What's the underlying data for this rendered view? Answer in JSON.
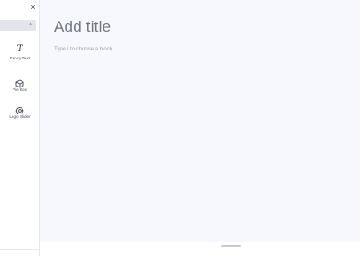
{
  "sidebar": {
    "close_glyph": "×",
    "search": {
      "value": "",
      "placeholder": "",
      "clear_glyph": "×"
    },
    "blocks": [
      {
        "label": "Fancy Text",
        "icon": "italic-t-icon"
      },
      {
        "label": "Pie Box",
        "icon": "cube-icon"
      },
      {
        "label": "Logo Slider",
        "icon": "logo-slider-icon"
      }
    ]
  },
  "editor": {
    "title_placeholder": "Add title",
    "block_prompt": "Type / to choose a block"
  }
}
